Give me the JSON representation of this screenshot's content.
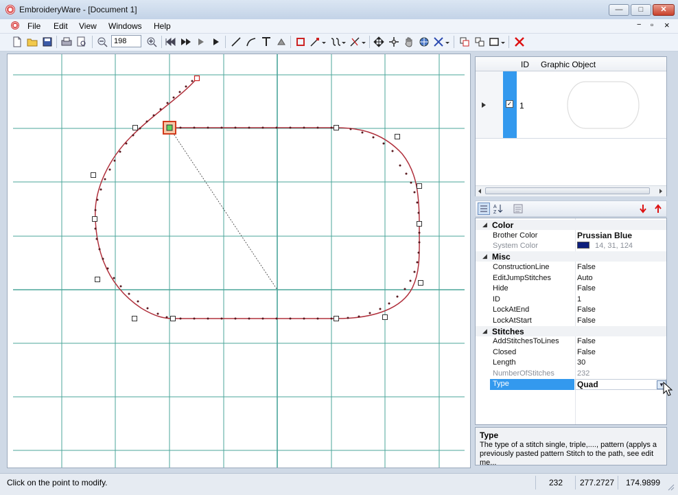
{
  "window": {
    "title": "EmbroideryWare - [Document 1]"
  },
  "menu": [
    "File",
    "Edit",
    "View",
    "Windows",
    "Help"
  ],
  "mdi_controls": [
    "−",
    "▫",
    "×"
  ],
  "toolbar": {
    "zoom_value": "198"
  },
  "object_grid": {
    "columns": [
      "ID",
      "Graphic Object"
    ],
    "rows": [
      {
        "id": "1",
        "checked": true
      }
    ]
  },
  "properties": {
    "categories": [
      {
        "name": "Color",
        "items": [
          {
            "name": "Brother Color",
            "value": "Prussian Blue"
          },
          {
            "name": "System Color",
            "value": "14, 31, 124"
          }
        ]
      },
      {
        "name": "Misc",
        "items": [
          {
            "name": "ConstructionLine",
            "value": "False"
          },
          {
            "name": "EditJumpStitches",
            "value": "Auto"
          },
          {
            "name": "Hide",
            "value": "False"
          },
          {
            "name": "ID",
            "value": "1"
          },
          {
            "name": "LockAtEnd",
            "value": "False"
          },
          {
            "name": "LockAtStart",
            "value": "False"
          }
        ]
      },
      {
        "name": "Stitches",
        "items": [
          {
            "name": "AddStitchesToLines",
            "value": "False"
          },
          {
            "name": "Closed",
            "value": "False"
          },
          {
            "name": "Length",
            "value": "30"
          },
          {
            "name": "NumberOfStitches",
            "value": "232"
          },
          {
            "name": "Type",
            "value": "Quad"
          }
        ]
      }
    ]
  },
  "description": {
    "title": "Type",
    "text": "The type of a stitch single, triple,...., pattern (applys a previously pasted pattern Stitch to the path, see edit me..."
  },
  "status": {
    "message": "Click on the point to modify.",
    "stitch_count": "232",
    "x": "277.2727",
    "y": "174.9899"
  },
  "colors": {
    "accent": "#3399ee",
    "path": "#b0303c",
    "grid": "#4aa59a",
    "swatch": "#0e1f7c"
  }
}
